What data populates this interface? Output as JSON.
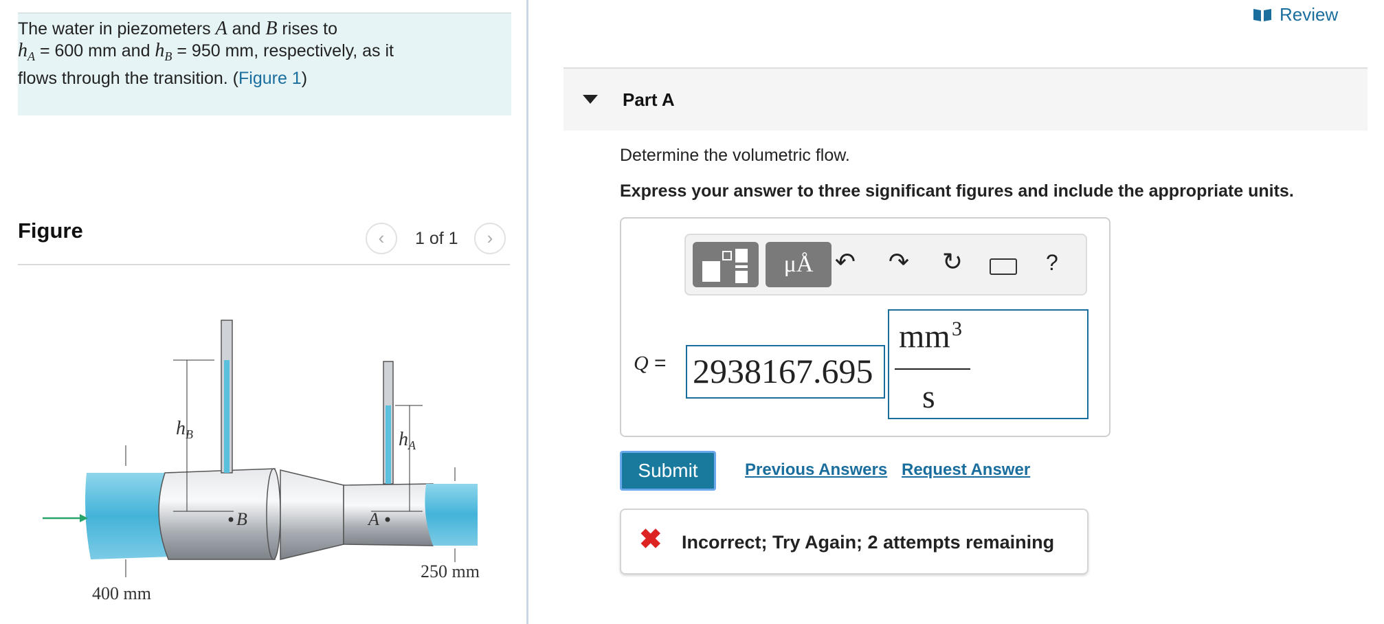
{
  "problem": {
    "text_before_A": "The water in piezometers ",
    "var_A": "A",
    "text_and": " and ",
    "var_B": "B",
    "text_rises": " rises to",
    "hA_symbol": "h",
    "hA_sub": "A",
    "hA_value": " = 600 mm",
    "text_and2": " and ",
    "hB_symbol": "h",
    "hB_sub": "B",
    "hB_value": " = 950 mm",
    "text_resp": ", respectively, as it",
    "text_line3": "flows through the transition. (",
    "figure_link": "Figure 1",
    "text_close": ")"
  },
  "figure": {
    "heading": "Figure",
    "counter": "1 of 1",
    "prev_icon": "chevron-left-icon",
    "next_icon": "chevron-right-icon",
    "labels": {
      "hB": "h",
      "hB_sub": "B",
      "hA": "h",
      "hA_sub": "A",
      "point_B": "B",
      "point_A": "A",
      "dim_small": "250 mm",
      "dim_large": "400 mm"
    },
    "colors": {
      "water": "#5bc0de",
      "pipe": "#b8bcc2",
      "arrow": "#2aa36b"
    }
  },
  "header": {
    "review_label": "Review",
    "review_icon": "book-icon"
  },
  "part": {
    "label": "Part A",
    "toggle_icon": "triangle-down-icon"
  },
  "question": {
    "prompt": "Determine the volumetric flow.",
    "instruction": "Express your answer to three significant figures and include the appropriate units."
  },
  "toolbar": {
    "templates_icon": "templates-icon",
    "units_label": "μÅ",
    "undo_icon": "undo-icon",
    "redo_icon": "redo-icon",
    "reset_icon": "reset-icon",
    "keyboard_icon": "keyboard-icon",
    "help_label": "?"
  },
  "answer": {
    "var_label": "Q",
    "equals": " =",
    "value": "2938167.695",
    "unit_numerator": "mm",
    "unit_exponent": "3",
    "unit_denominator": "s"
  },
  "actions": {
    "submit": "Submit",
    "previous_answers": "Previous Answers",
    "request_answer": "Request Answer"
  },
  "feedback": {
    "icon": "✖",
    "message": "Incorrect; Try Again; 2 attempts remaining",
    "color": "#dd2222"
  }
}
